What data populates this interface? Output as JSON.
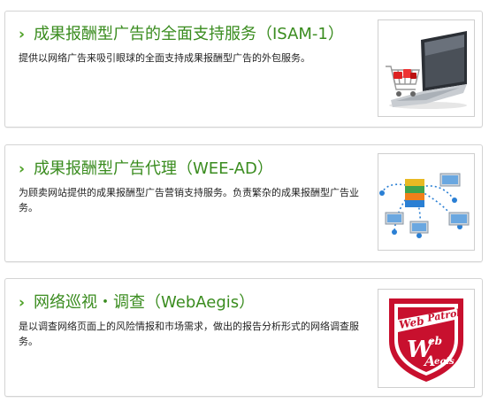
{
  "services": [
    {
      "title": "成果报酬型广告的全面支持服务（ISAM-1）",
      "description": "提供以网络广告来吸引眼球的全面支持成果报酬型广告的外包服务。",
      "image": "laptop-shopping-cart-icon"
    },
    {
      "title": "成果报酬型广告代理（WEE-AD）",
      "description": "为顾卖网站提供的成果报酬型广告营销支持服务。负责繁杂的成果报酬型广告业务。",
      "image": "network-computers-icon"
    },
    {
      "title": "网络巡视・调查（WebAegis）",
      "description": "是以调查网络页面上的风险情报和市场需求，做出的报告分析形式的网络调查服务。",
      "image": "web-patrol-shield-logo",
      "logo_text": "Web Patrol WebAegis"
    }
  ],
  "icons": {
    "chevron": "›"
  },
  "colors": {
    "title": "#3a8c1f",
    "shield_red": "#c8102e",
    "border": "#d4d4d4"
  }
}
